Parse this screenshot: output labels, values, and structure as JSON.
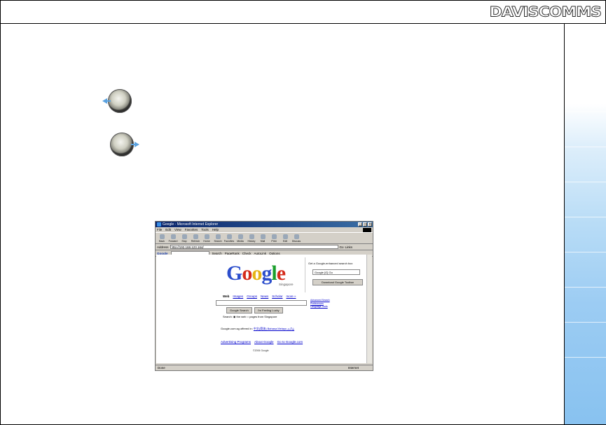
{
  "slide": {
    "logo_text": "DAVISCOMMS",
    "side_panel_color": "#88c2f0"
  },
  "nav": {
    "back_icon": "arrow-left-icon",
    "forward_icon": "arrow-right-icon",
    "accent_color": "#5aa2e0"
  },
  "browser": {
    "title": "Google - Microsoft Internet Explorer",
    "menu": [
      "File",
      "Edit",
      "View",
      "Favorites",
      "Tools",
      "Help"
    ],
    "toolbar": [
      "Back",
      "Forward",
      "Stop",
      "Refresh",
      "Home",
      "Search",
      "Favorites",
      "Media",
      "History",
      "Mail",
      "Print",
      "Edit",
      "Discuss"
    ],
    "address_label": "Address",
    "address_value": "http://192.168.123.164/",
    "go_label": "Go",
    "links_label": "Links",
    "google_toolbar": {
      "logo": "Google",
      "search_label": "Search",
      "pagerank_label": "PageRank",
      "check_label": "Check",
      "autolink_label": "AutoLink",
      "options_label": "Options"
    },
    "status": "Done",
    "zone": "Internet"
  },
  "google_page": {
    "logo": "Google",
    "region": "Singapore",
    "toolbar_promo": {
      "title": "Get a Google-enhanced search box",
      "input_value": "Google [G]",
      "go": "Go",
      "button": "Download Google Toolbar"
    },
    "tabs": [
      "Web",
      "Images",
      "Groups",
      "News",
      "Scholar",
      "more »"
    ],
    "side_links": [
      "Advanced Search",
      "Preferences",
      "Language Tools"
    ],
    "buttons": [
      "Google Search",
      "I'm Feeling Lucky"
    ],
    "search_option": "Search: ◉ the web ○ pages from Singapore",
    "offered_text": "Google.com.sg offered in:",
    "offered_links": "中文(简体) Bahasa Melayu தமிழ்",
    "footer": [
      "Advertising Programs",
      "About Google",
      "Go to Google.com"
    ],
    "copyright": "©2006 Google"
  }
}
